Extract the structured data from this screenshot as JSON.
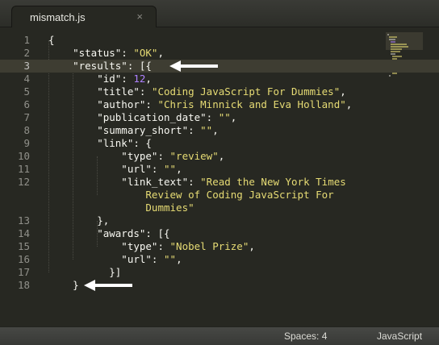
{
  "tab": {
    "filename": "mismatch.js",
    "close_glyph": "×"
  },
  "lines": [
    {
      "num": "1",
      "tokens": [
        {
          "t": "{",
          "c": "p"
        }
      ]
    },
    {
      "num": "2",
      "tokens": [
        {
          "t": "    \"status\": ",
          "c": "p"
        },
        {
          "t": "\"OK\"",
          "c": "s"
        },
        {
          "t": ",",
          "c": "p"
        }
      ]
    },
    {
      "num": "3",
      "tokens": [
        {
          "t": "    \"results\": [{",
          "c": "p"
        }
      ]
    },
    {
      "num": "4",
      "tokens": [
        {
          "t": "        \"id\": ",
          "c": "p"
        },
        {
          "t": "12",
          "c": "n"
        },
        {
          "t": ",",
          "c": "p"
        }
      ]
    },
    {
      "num": "5",
      "tokens": [
        {
          "t": "        \"title\": ",
          "c": "p"
        },
        {
          "t": "\"Coding JavaScript For Dummies\"",
          "c": "s"
        },
        {
          "t": ",",
          "c": "p"
        }
      ]
    },
    {
      "num": "6",
      "tokens": [
        {
          "t": "        \"author\": ",
          "c": "p"
        },
        {
          "t": "\"Chris Minnick and Eva Holland\"",
          "c": "s"
        },
        {
          "t": ",",
          "c": "p"
        }
      ]
    },
    {
      "num": "7",
      "tokens": [
        {
          "t": "        \"publication_date\": ",
          "c": "p"
        },
        {
          "t": "\"\"",
          "c": "s"
        },
        {
          "t": ",",
          "c": "p"
        }
      ]
    },
    {
      "num": "8",
      "tokens": [
        {
          "t": "        \"summary_short\": ",
          "c": "p"
        },
        {
          "t": "\"\"",
          "c": "s"
        },
        {
          "t": ",",
          "c": "p"
        }
      ]
    },
    {
      "num": "9",
      "tokens": [
        {
          "t": "        \"link\": {",
          "c": "p"
        }
      ]
    },
    {
      "num": "10",
      "tokens": [
        {
          "t": "            \"type\": ",
          "c": "p"
        },
        {
          "t": "\"review\"",
          "c": "s"
        },
        {
          "t": ",",
          "c": "p"
        }
      ]
    },
    {
      "num": "11",
      "tokens": [
        {
          "t": "            \"url\": ",
          "c": "p"
        },
        {
          "t": "\"\"",
          "c": "s"
        },
        {
          "t": ",",
          "c": "p"
        }
      ]
    },
    {
      "num": "12",
      "tokens": [
        {
          "t": "            \"link_text\": ",
          "c": "p"
        },
        {
          "t": "\"Read the New York Times",
          "c": "s"
        }
      ]
    },
    {
      "num": "",
      "tokens": [
        {
          "t": "                Review of Coding JavaScript For",
          "c": "s"
        }
      ]
    },
    {
      "num": "",
      "tokens": [
        {
          "t": "                Dummies\"",
          "c": "s"
        }
      ]
    },
    {
      "num": "13",
      "tokens": [
        {
          "t": "        },",
          "c": "p"
        }
      ]
    },
    {
      "num": "14",
      "tokens": [
        {
          "t": "        \"awards\": [{",
          "c": "p"
        }
      ]
    },
    {
      "num": "15",
      "tokens": [
        {
          "t": "            \"type\": ",
          "c": "p"
        },
        {
          "t": "\"Nobel Prize\"",
          "c": "s"
        },
        {
          "t": ",",
          "c": "p"
        }
      ]
    },
    {
      "num": "16",
      "tokens": [
        {
          "t": "            \"url\": ",
          "c": "p"
        },
        {
          "t": "\"\"",
          "c": "s"
        },
        {
          "t": ",",
          "c": "p"
        }
      ]
    },
    {
      "num": "17",
      "tokens": [
        {
          "t": "          }]",
          "c": "p"
        }
      ]
    },
    {
      "num": "18",
      "tokens": [
        {
          "t": "    }",
          "c": "p"
        }
      ]
    }
  ],
  "current_line": "3",
  "annotations": [
    {
      "name": "arrow-line-3",
      "line": "3",
      "icon": "left-arrow-icon"
    },
    {
      "name": "arrow-line-18",
      "line": "18",
      "icon": "left-arrow-icon"
    }
  ],
  "status": {
    "indent": "Spaces: 4",
    "syntax": "JavaScript"
  },
  "colors": {
    "background": "#272822",
    "string": "#e6db74",
    "number": "#ae81ff",
    "text": "#f8f8f2",
    "gutter": "#90908a"
  }
}
